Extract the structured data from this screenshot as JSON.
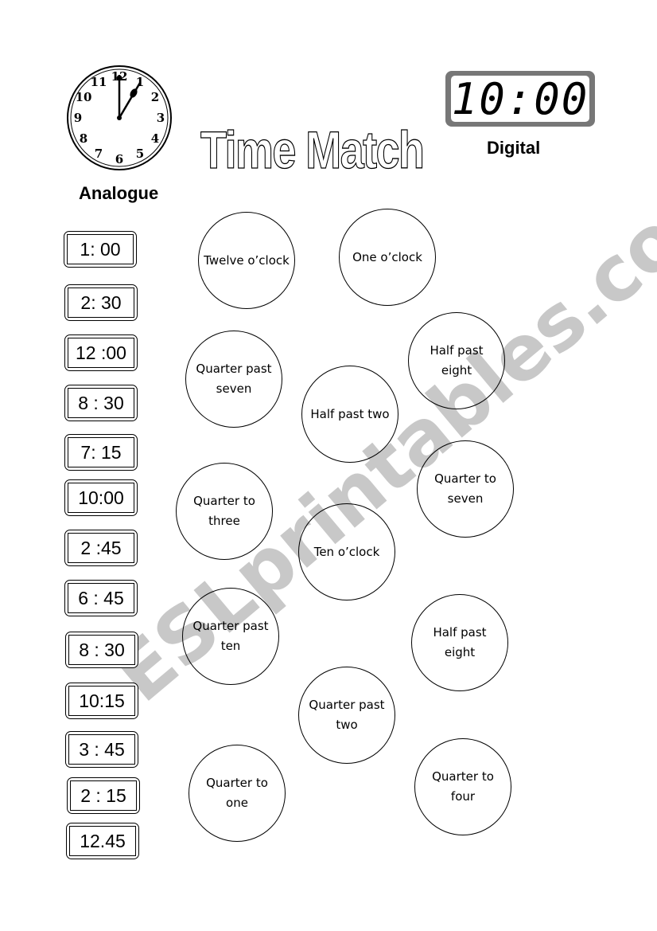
{
  "header": {
    "title": "Time Match",
    "analogue_label": "Analogue",
    "digital_label": "Digital",
    "digital_display": "10:00",
    "analogue_clock": {
      "icon": "analogue-clock-icon",
      "time_shown": "1:00",
      "numbers": [
        "12",
        "1",
        "2",
        "3",
        "4",
        "5",
        "6",
        "7",
        "8",
        "9",
        "10",
        "11"
      ]
    }
  },
  "watermark": "ESLprintables.com",
  "digital_times": [
    "1: 00",
    "2: 30",
    "12 :00",
    "8 : 30",
    "7: 15",
    "10:00",
    "2 :45",
    "6 : 45",
    "8 : 30",
    "10:15",
    "3 : 45",
    "2 : 15",
    "12.45"
  ],
  "phrases": [
    "Twelve o’clock",
    "One o’clock",
    "Quarter past seven",
    "Half past two",
    "Half past eight",
    "Quarter to three",
    "Ten o’clock",
    "Quarter to seven",
    "Quarter past ten",
    "Half past eight",
    "Quarter past two",
    "Quarter to one",
    "Quarter to four"
  ]
}
